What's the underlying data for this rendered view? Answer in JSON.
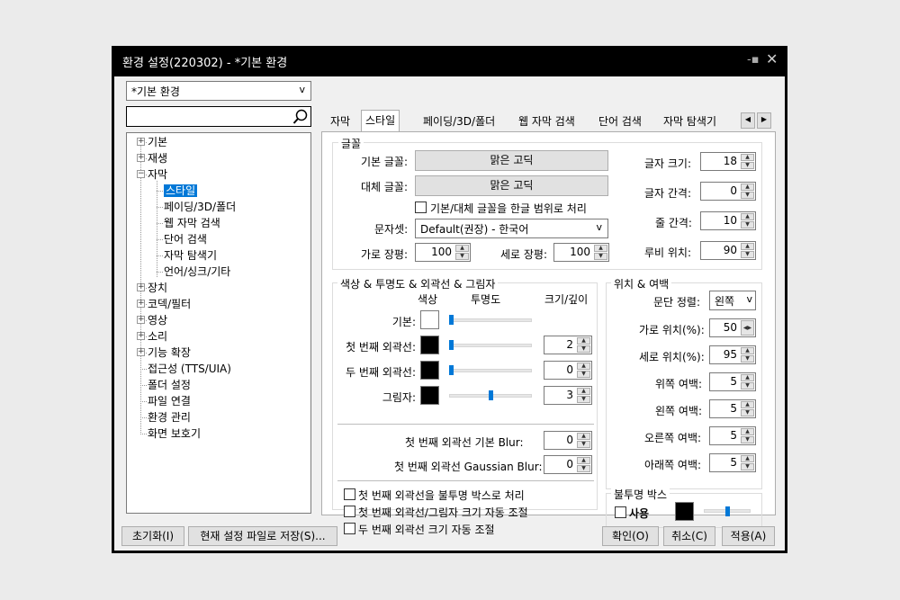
{
  "title": "환경 설정(220302) - *기본 환경",
  "profile_combo": {
    "value": "*기본 환경",
    "arrow": "v"
  },
  "tree": {
    "items": [
      {
        "label": "기본",
        "expander": "+"
      },
      {
        "label": "재생",
        "expander": "+"
      },
      {
        "label": "자막",
        "expander": "−"
      },
      {
        "label": "스타일"
      },
      {
        "label": "페이딩/3D/폴더"
      },
      {
        "label": "웹 자막 검색"
      },
      {
        "label": "단어 검색"
      },
      {
        "label": "자막 탐색기"
      },
      {
        "label": "언어/싱크/기타"
      },
      {
        "label": "장치",
        "expander": "+"
      },
      {
        "label": "코덱/필터",
        "expander": "+"
      },
      {
        "label": "영상",
        "expander": "+"
      },
      {
        "label": "소리",
        "expander": "+"
      },
      {
        "label": "기능 확장",
        "expander": "+"
      },
      {
        "label": "접근성 (TTS/UIA)"
      },
      {
        "label": "폴더 설정"
      },
      {
        "label": "파일 연결"
      },
      {
        "label": "환경 관리"
      },
      {
        "label": "화면 보호기"
      }
    ]
  },
  "tabs": [
    "자막",
    "스타일",
    "페이딩/3D/폴더",
    "웹 자막 검색",
    "단어 검색",
    "자막 탐색기"
  ],
  "font_group": {
    "title": "글꼴",
    "base_font_label": "기본 글꼴:",
    "base_font_value": "맑은 고딕",
    "alt_font_label": "대체 글꼴:",
    "alt_font_value": "맑은 고딕",
    "hangul_range_label": "기본/대체 글꼴을 한글 범위로 처리",
    "charset_label": "문자셋:",
    "charset_value": "Default(권장) - 한국어",
    "hscale_label": "가로 장평:",
    "hscale_value": "100",
    "vscale_label": "세로 장평:",
    "vscale_value": "100",
    "font_size_label": "글자 크기:",
    "font_size_value": "18",
    "char_spacing_label": "글자 간격:",
    "char_spacing_value": "0",
    "line_spacing_label": "줄 간격:",
    "line_spacing_value": "10",
    "ruby_pos_label": "루비 위치:",
    "ruby_pos_value": "90"
  },
  "color_group": {
    "title": "색상 & 투명도 & 외곽선 & 그림자",
    "col_color": "색상",
    "col_opacity": "투명도",
    "col_size": "크기/깊이",
    "rows": [
      {
        "label": "기본:",
        "color": "#ffffff",
        "opacity": 0.0,
        "size": null
      },
      {
        "label": "첫 번째 외곽선:",
        "color": "#000000",
        "opacity": 0.0,
        "size": "2"
      },
      {
        "label": "두 번째 외곽선:",
        "color": "#000000",
        "opacity": 0.0,
        "size": "0"
      },
      {
        "label": "그림자:",
        "color": "#000000",
        "opacity": 0.5,
        "size": "3"
      }
    ],
    "blur_label": "첫 번째 외곽선 기본 Blur:",
    "blur_value": "0",
    "gauss_label": "첫 번째 외곽선 Gaussian Blur:",
    "gauss_value": "0",
    "chk_opaque_box": "첫 번째 외곽선을 불투명 박스로 처리",
    "chk_auto_size1": "첫 번째 외곽선/그림자 크기 자동 조절",
    "chk_auto_size2": "두 번째 외곽선 크기 자동 조절"
  },
  "position_group": {
    "title": "위치 & 여백",
    "align_label": "문단 정렬:",
    "align_value": "왼쪽",
    "hpos_label": "가로 위치(%):",
    "hpos_value": "50",
    "vpos_label": "세로 위치(%):",
    "vpos_value": "95",
    "top_margin_label": "위쪽 여백:",
    "top_margin_value": "5",
    "left_margin_label": "왼쪽 여백:",
    "left_margin_value": "5",
    "right_margin_label": "오른쪽 여백:",
    "right_margin_value": "5",
    "bottom_margin_label": "아래쪽 여백:",
    "bottom_margin_value": "5"
  },
  "opaque_group": {
    "title": "불투명 박스",
    "use_label": "사용",
    "color": "#000000",
    "opacity": 0.5
  },
  "buttons": {
    "reset": "초기화(I)",
    "save_file": "현재 설정 파일로 저장(S)...",
    "ok": "확인(O)",
    "cancel": "취소(C)",
    "apply": "적용(A)"
  },
  "colors": {
    "accent": "#0078d7",
    "window_frame": "#000000",
    "client_bg": "#f0f0f0"
  }
}
